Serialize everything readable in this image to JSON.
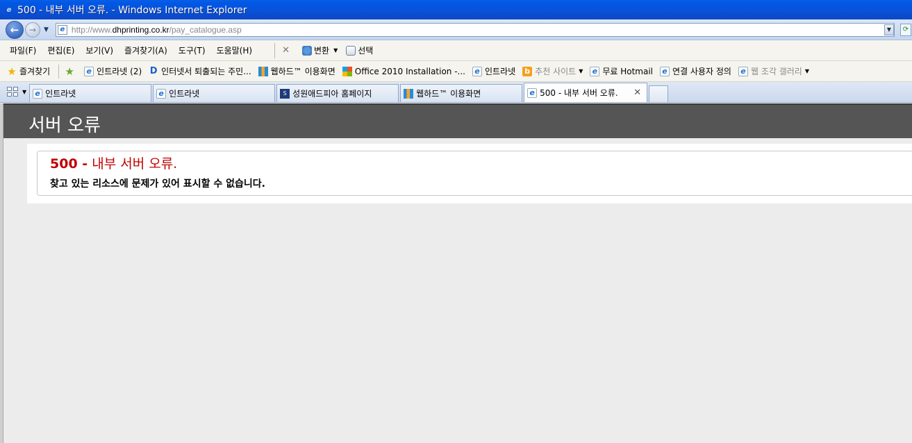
{
  "window": {
    "title": "500 - 내부 서버 오류. - Windows Internet Explorer"
  },
  "address": {
    "url_prefix": "http://www.",
    "url_domain": "dhprinting.co.kr",
    "url_path": "/pay_catalogue.asp"
  },
  "menu": {
    "items": [
      "파일(F)",
      "편집(E)",
      "보기(V)",
      "즐겨찾기(A)",
      "도구(T)",
      "도움말(H)"
    ],
    "translate": "변환",
    "select": "선택"
  },
  "favorites": {
    "label": "즐겨찾기",
    "items": [
      "인트라넷 (2)",
      "인터넷서 퇴출되는 주민...",
      "웹하드™ 이용화면",
      "Office 2010 Installation -...",
      "인트라넷",
      "추천 사이트",
      "무료 Hotmail",
      "연결 사용자 정의",
      "웹 조각 갤러리"
    ]
  },
  "tabs": [
    {
      "label": "인트라넷"
    },
    {
      "label": "인트라넷"
    },
    {
      "label": "성원애드피아 홈페이지"
    },
    {
      "label": "웹하드™ 이용화면"
    },
    {
      "label": "500 - 내부 서버 오류."
    }
  ],
  "page": {
    "header": "서버 오류",
    "error_code": "500 -",
    "error_title": "내부 서버 오류.",
    "error_message": "찾고 있는 리소스에 문제가 있어 표시할 수 없습니다."
  },
  "icons": {
    "back": "back-arrow-icon",
    "forward": "forward-arrow-icon",
    "page": "ie-page-icon"
  }
}
